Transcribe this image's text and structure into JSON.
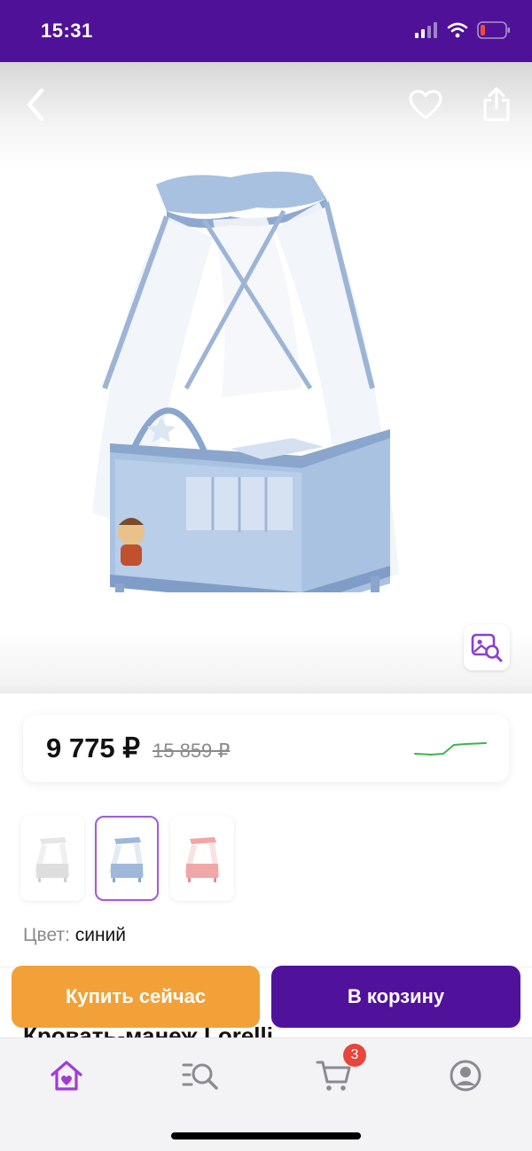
{
  "status_bar": {
    "time": "15:31",
    "icons": [
      "signal-icon",
      "wifi-icon",
      "battery-icon"
    ]
  },
  "gallery": {
    "icons": [
      "back-arrow-icon",
      "heart-icon",
      "share-icon",
      "visual-search-icon"
    ],
    "image": "crib-with-canopy"
  },
  "price": {
    "current": "9 775 ₽",
    "old": "15 859 ₽",
    "trend_icon": "price-history-sparkline"
  },
  "variants": {
    "items": [
      {
        "color": "white",
        "selected": false
      },
      {
        "color": "blue",
        "selected": true
      },
      {
        "color": "pink",
        "selected": false
      }
    ]
  },
  "color": {
    "label": "Цвет:",
    "value": "синий"
  },
  "actions": {
    "buy_now": "Купить сейчас",
    "add_to_cart": "В корзину"
  },
  "product": {
    "title_partial": "Кровать-манеж Lorelli"
  },
  "bottom_nav": {
    "items": [
      "home-icon",
      "catalog-search-icon",
      "cart-icon",
      "profile-icon"
    ],
    "cart_badge": "3"
  },
  "colors": {
    "brand_purple": "#51129b",
    "accent_orange": "#f1a138",
    "badge_red": "#e8453c",
    "trend_green": "#3bb54a"
  }
}
